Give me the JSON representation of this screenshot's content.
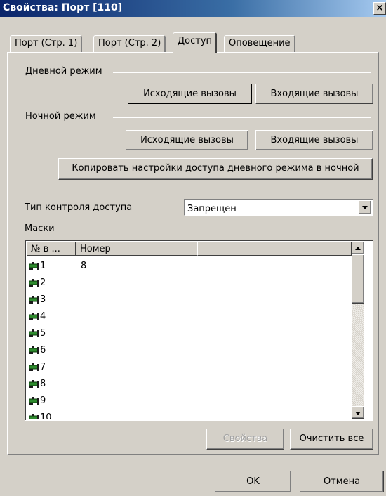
{
  "window": {
    "title": "Свойства: Порт [110]",
    "close_glyph": "×"
  },
  "tabs": [
    {
      "label": "Порт (Стр. 1)",
      "active": false
    },
    {
      "label": "Порт (Стр. 2)",
      "active": false
    },
    {
      "label": "Доступ",
      "active": true
    },
    {
      "label": "Оповещение",
      "active": false
    }
  ],
  "day_mode": {
    "label": "Дневной режим",
    "outgoing_button": "Исходящие вызовы",
    "incoming_button": "Входящие вызовы"
  },
  "night_mode": {
    "label": "Ночной режим",
    "outgoing_button": "Исходящие вызовы",
    "incoming_button": "Входящие вызовы"
  },
  "copy_button": "Копировать настройки доступа дневного режима в ночной",
  "access_control": {
    "label": "Тип контроля доступа",
    "value": "Запрещен"
  },
  "masks": {
    "label": "Маски",
    "columns": [
      "№ в ...",
      "Номер"
    ],
    "rows": [
      {
        "index": "1",
        "mask": "8"
      },
      {
        "index": "2",
        "mask": ""
      },
      {
        "index": "3",
        "mask": ""
      },
      {
        "index": "4",
        "mask": ""
      },
      {
        "index": "5",
        "mask": ""
      },
      {
        "index": "6",
        "mask": ""
      },
      {
        "index": "7",
        "mask": ""
      },
      {
        "index": "8",
        "mask": ""
      },
      {
        "index": "9",
        "mask": ""
      },
      {
        "index": "10",
        "mask": ""
      }
    ]
  },
  "list_buttons": {
    "properties": "Свойства",
    "clear_all": "Очистить все"
  },
  "dialog_buttons": {
    "ok": "OK",
    "cancel": "Отмена"
  },
  "icons": {
    "row_icon": "mask-row-icon",
    "combo_arrow": "chevron-down-icon"
  }
}
